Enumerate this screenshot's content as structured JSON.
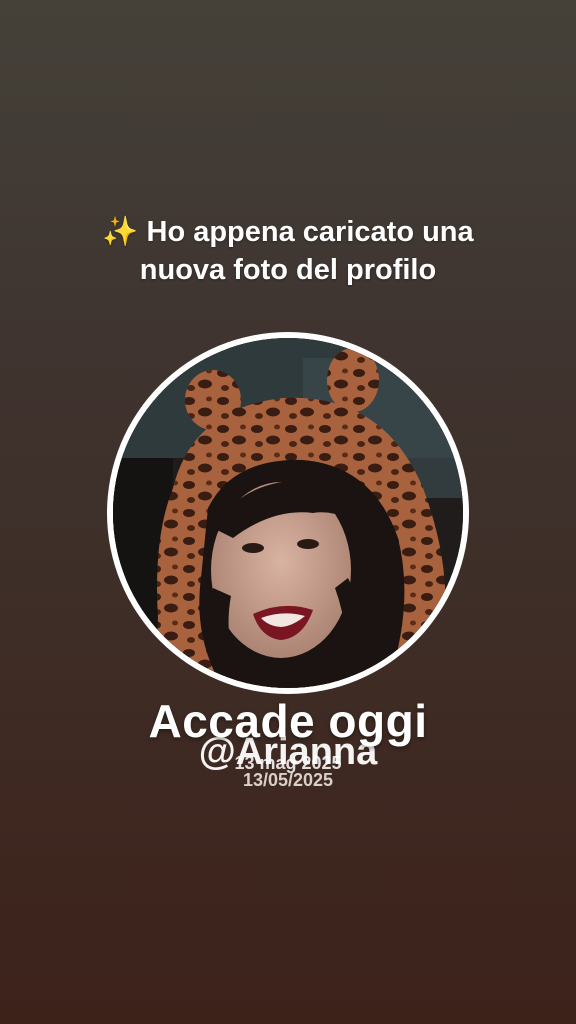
{
  "headline": {
    "icon": "sparkles-icon",
    "sparkle": "✨",
    "line1": "Ho appena caricato una",
    "line2": "nuova foto del profilo"
  },
  "avatar": {
    "icon": "profile-photo",
    "ring_color": "#ffffff"
  },
  "memory": {
    "title": "Accade oggi",
    "handle": "@Arianna",
    "date_short": "13 mag 2025",
    "date_numeric": "13/05/2025"
  },
  "colors": {
    "background_top": "#454139",
    "background_bottom": "#3d221a",
    "text": "#ffffff"
  }
}
